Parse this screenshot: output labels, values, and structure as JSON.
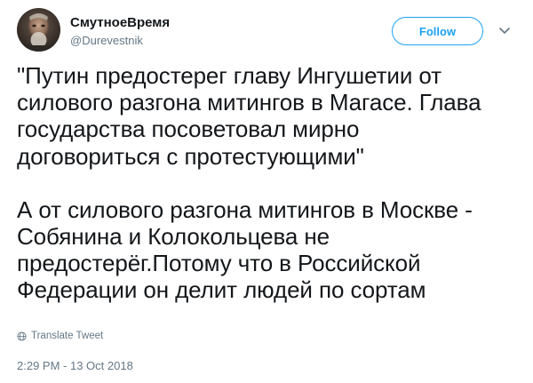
{
  "author": {
    "display_name": "СмутноеВремя",
    "handle": "@Durevestnik"
  },
  "follow_button": {
    "label": "Follow"
  },
  "tweet": {
    "lines_p1": [
      "\"Путин предостерег главу Ингушетии от",
      "силового разгона митингов в Магасе. Глава",
      "государства посоветовал мирно",
      "договориться с протестующими\""
    ],
    "lines_p2": [
      "А от силового разгона митингов в Москве -",
      "Собянина и Колокольцева не",
      "предостерёг.Потому что в Российской",
      "Федерации он делит людей по сортам"
    ]
  },
  "translate": {
    "label": "Translate Tweet",
    "icon": "globe-icon"
  },
  "meta": {
    "timestamp": "2:29 PM - 13 Oct 2018"
  },
  "colors": {
    "accent": "#1da1f2",
    "text": "#14171a",
    "secondary": "#657786"
  }
}
